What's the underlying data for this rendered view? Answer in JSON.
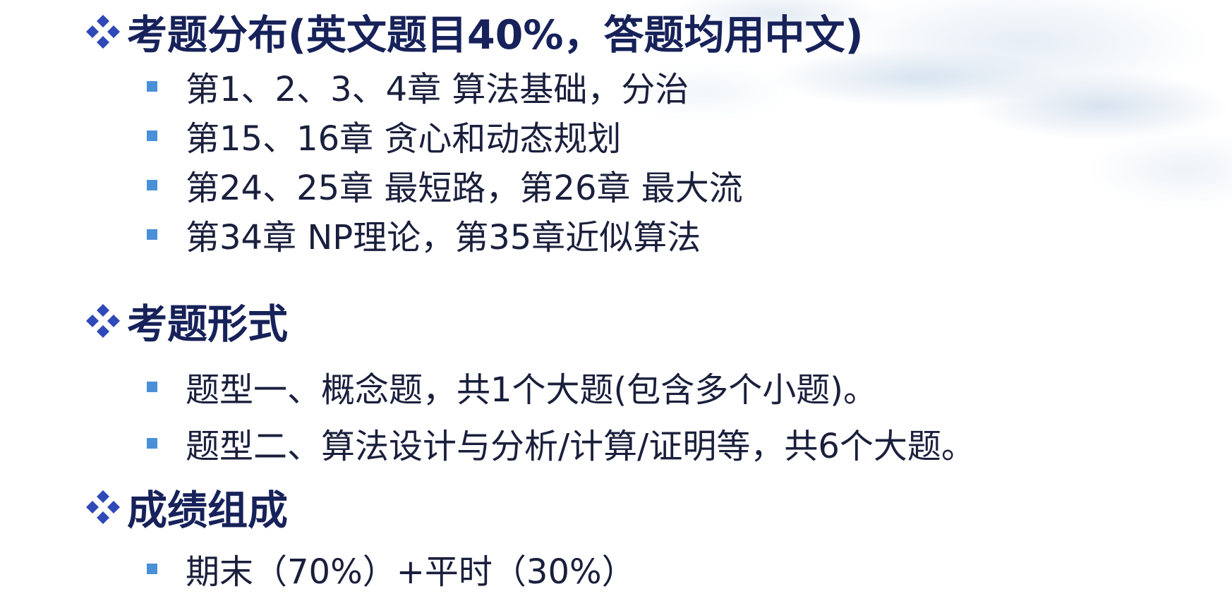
{
  "sections": [
    {
      "heading": "考题分布(英文题目40%，答题均用中文)",
      "items": [
        "第1、2、3、4章 算法基础，分治",
        "第15、16章 贪心和动态规划",
        "第24、25章 最短路，第26章 最大流",
        "第34章 NP理论，第35章近似算法"
      ]
    },
    {
      "heading": "考题形式",
      "items": [
        "题型一、概念题，共1个大题(包含多个小题)。",
        "题型二、算法设计与分析/计算/证明等，共6个大题。"
      ]
    },
    {
      "heading": "成绩组成",
      "items": [
        "期末（70%）+平时（30%）"
      ]
    }
  ],
  "icons": {
    "heading_marker": "four-diamond-bullet-icon",
    "item_marker": "square-bullet-icon"
  },
  "colors": {
    "heading_text": "#17225a",
    "item_text": "#1a1f3c",
    "diamond_marker": "#2f49b8",
    "square_marker": "#4a90d8"
  }
}
